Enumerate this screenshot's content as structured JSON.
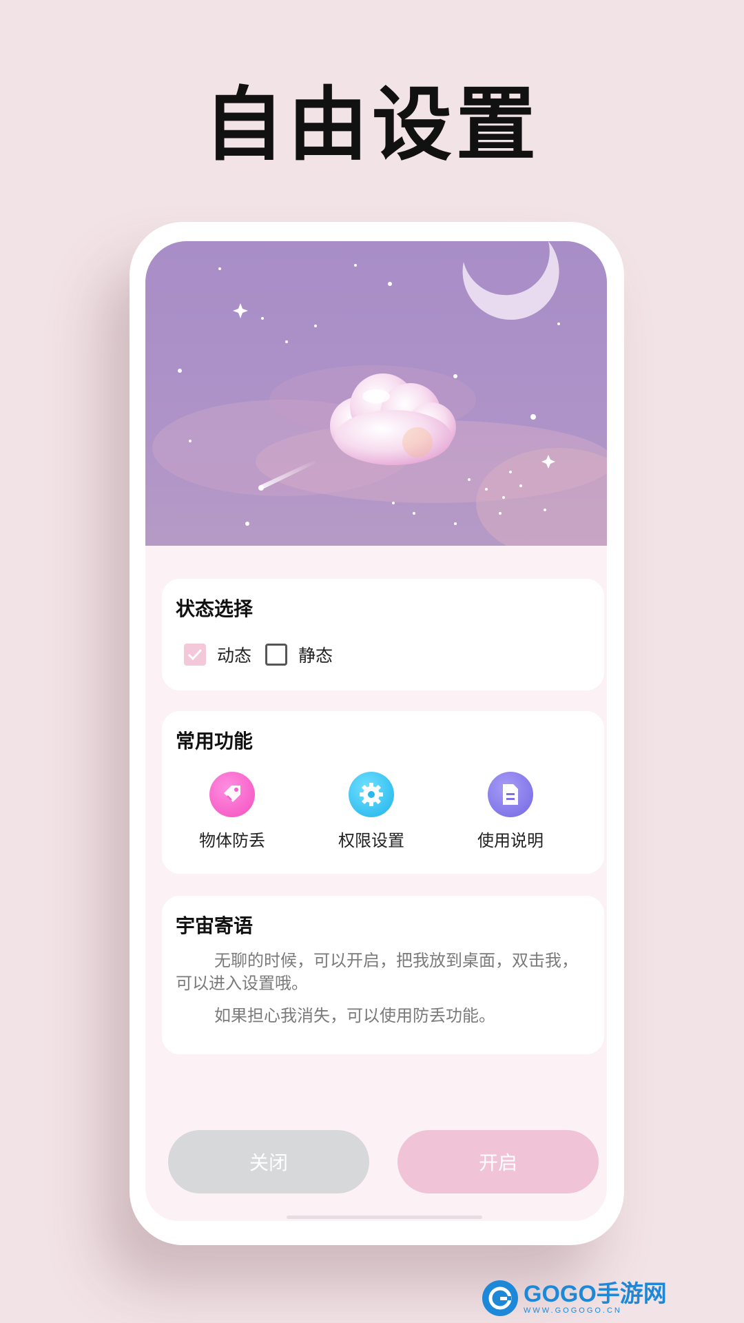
{
  "headline": "自由设置",
  "status_card": {
    "title": "状态选择",
    "options": [
      {
        "label": "动态",
        "checked": true
      },
      {
        "label": "静态",
        "checked": false
      }
    ]
  },
  "functions_card": {
    "title": "常用功能",
    "items": [
      {
        "label": "物体防丢",
        "icon": "tag-icon",
        "color": "#ff5fc8"
      },
      {
        "label": "权限设置",
        "icon": "gear-icon",
        "color": "#2fc3f0"
      },
      {
        "label": "使用说明",
        "icon": "document-icon",
        "color": "#7f74ea"
      }
    ]
  },
  "message_card": {
    "title": "宇宙寄语",
    "paragraphs": [
      "无聊的时候，可以开启，把我放到桌面，双击我，可以进入设置哦。",
      "如果担心我消失，可以使用防丢功能。"
    ]
  },
  "buttons": {
    "close": "关闭",
    "open": "开启"
  },
  "watermark": {
    "brand": "GOGO手游网",
    "url": "WWW.GOGOGO.CN"
  },
  "colors": {
    "background": "#f2e3e6",
    "hero_sky": "#a98fc6",
    "checked_box": "#f3c8d8",
    "open_button": "#f0c3d6",
    "close_button": "#d7d8da"
  }
}
